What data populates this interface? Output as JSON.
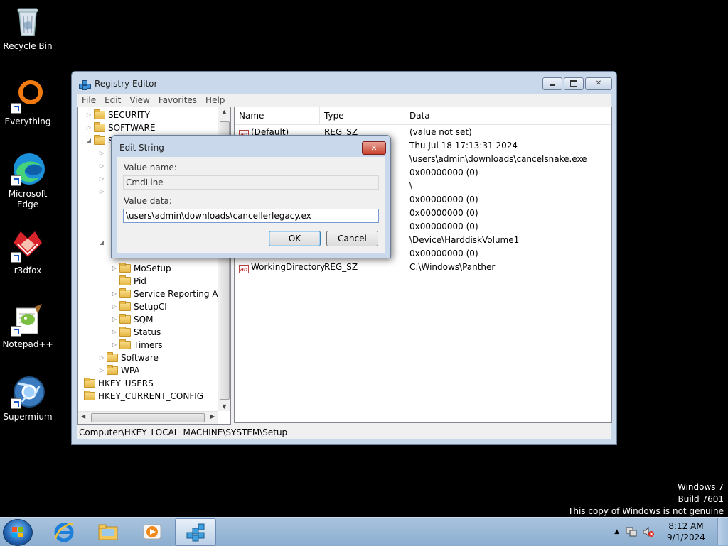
{
  "desktop": {
    "icons": [
      {
        "label": "Recycle Bin",
        "icon": "recycle-bin-icon"
      },
      {
        "label": "Everything",
        "icon": "everything-icon"
      },
      {
        "label": "Microsoft Edge",
        "icon": "edge-icon"
      },
      {
        "label": "r3dfox",
        "icon": "r3dfox-icon"
      },
      {
        "label": "Notepad++",
        "icon": "notepadpp-icon"
      },
      {
        "label": "Supermium",
        "icon": "supermium-icon"
      }
    ]
  },
  "window": {
    "title": "Registry Editor",
    "menu": [
      "File",
      "Edit",
      "View",
      "Favorites",
      "Help"
    ],
    "tree": [
      {
        "label": "SECURITY"
      },
      {
        "label": "SOFTWARE"
      },
      {
        "label": "S"
      },
      {
        "label": "MoSetup"
      },
      {
        "label": "Pid"
      },
      {
        "label": "Service Reporting API"
      },
      {
        "label": "SetupCI"
      },
      {
        "label": "SQM"
      },
      {
        "label": "Status"
      },
      {
        "label": "Timers"
      },
      {
        "label": "Software"
      },
      {
        "label": "WPA"
      },
      {
        "label": "HKEY_USERS"
      },
      {
        "label": "HKEY_CURRENT_CONFIG"
      }
    ],
    "columns": {
      "name": "Name",
      "type": "Type",
      "data": "Data"
    },
    "rows": [
      {
        "name": "(Default)",
        "type": "REG_SZ",
        "data": "(value not set)"
      },
      {
        "name": "",
        "type": "",
        "data": "Thu Jul 18 17:13:31 2024"
      },
      {
        "name": "",
        "type": "",
        "data": "\\users\\admin\\downloads\\cancelsnake.exe"
      },
      {
        "name": "",
        "type": "",
        "data": "0x00000000 (0)"
      },
      {
        "name": "",
        "type": "",
        "data": "\\"
      },
      {
        "name": "",
        "type": "",
        "data": "0x00000000 (0)"
      },
      {
        "name": "",
        "type": "",
        "data": "0x00000000 (0)"
      },
      {
        "name": "",
        "type": "",
        "data": "0x00000000 (0)"
      },
      {
        "name": "",
        "type": "",
        "data": "\\Device\\HarddiskVolume1"
      },
      {
        "name": "",
        "type": "",
        "data": "0x00000000 (0)"
      },
      {
        "name": "WorkingDirectory",
        "type": "REG_SZ",
        "data": "C:\\Windows\\Panther"
      }
    ],
    "status": "Computer\\HKEY_LOCAL_MACHINE\\SYSTEM\\Setup"
  },
  "dialog": {
    "title": "Edit String",
    "value_name_label": "Value name:",
    "value_name": "CmdLine",
    "value_data_label": "Value data:",
    "value_data": "\\users\\admin\\downloads\\cancellerlegacy.ex",
    "ok": "OK",
    "cancel": "Cancel"
  },
  "watermark": {
    "line1": "Windows 7",
    "line2": "Build 7601",
    "line3": "This copy of Windows is not genuine"
  },
  "taskbar": {
    "time": "8:12 AM",
    "date": "9/1/2024"
  }
}
